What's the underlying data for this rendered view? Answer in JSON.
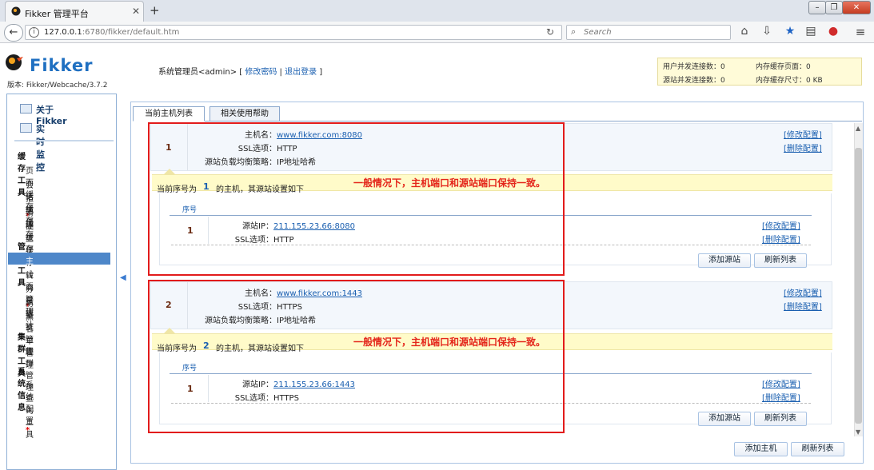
{
  "browser": {
    "tab_title": "Fikker 管理平台",
    "url_host": "127.0.0.1",
    "url_rest": ":6780/fikker/default.htm",
    "search_placeholder": "Search",
    "window_buttons": [
      "–",
      "❐",
      "✕"
    ],
    "new_tab": "+",
    "icons": [
      "back-icon",
      "info-icon",
      "reload-icon",
      "search-icon",
      "home-icon",
      "download-icon",
      "bookmark-star-icon",
      "reading-list-icon",
      "record-icon",
      "menu-icon"
    ]
  },
  "header": {
    "logo_text": "Fikker",
    "version": "版本: Fikker/Webcache/3.7.2",
    "user_prefix": "系统管理员<admin> [ ",
    "change_password": "修改密码",
    "separator": " | ",
    "logout": "退出登录",
    "user_suffix": " ]",
    "stats": {
      "user_conn_label": "用户并发连接数：0",
      "mem_pages_label": "内存缓存页面：0",
      "origin_conn_label": "源站并发连接数：0",
      "mem_size_label": "内存缓存尺寸：0 KB"
    }
  },
  "sidebar": {
    "top_items": [
      "关于Fikker",
      "实时监控"
    ],
    "groups": [
      {
        "title": "缓存工具",
        "items": [
          {
            "label": "页面缓存",
            "star": "*"
          },
          {
            "label": "会话缓存",
            "star": ""
          },
          {
            "label": "拒绝缓存",
            "star": ""
          },
          {
            "label": "清理缓存",
            "star": ""
          },
          {
            "label": "硬盘缓存设置",
            "star": ""
          }
        ]
      },
      {
        "title": "管理工具",
        "items": [
          {
            "label": "主机管理",
            "star": "*"
          },
          {
            "label": "转向管理",
            "star": ""
          },
          {
            "label": "分量统计",
            "star": ""
          },
          {
            "label": "防盗链管理",
            "star": ""
          },
          {
            "label": "黑名单管理",
            "star": ""
          }
        ]
      },
      {
        "title": "集群工具",
        "items": [
          {
            "label": "集群管理",
            "star": ""
          }
        ]
      },
      {
        "title": "系统信息",
        "items": [
          {
            "label": "系统配置",
            "star": "*"
          },
          {
            "label": "查询工具",
            "star": ""
          }
        ]
      }
    ],
    "active_item": "主机管理"
  },
  "content": {
    "tabs": [
      "当前主机列表",
      "相关使用帮助"
    ],
    "labels": {
      "hostname": "主机名：",
      "ssl": "SSL选项：",
      "balance": "源站负载均衡策略：",
      "origin_ip": "源站IP：",
      "seq": "序号",
      "edit": "[修改配置]",
      "delete": "[删除配置]",
      "current_seq": "当前序号为",
      "host_suffix": "的主机，其源站设置如下",
      "add_origin": "添加源站",
      "refresh": "刷新列表"
    },
    "hosts": [
      {
        "num": "1",
        "hostname": "www.fikker.com:8080",
        "ssl": "HTTP",
        "balance": "IP地址哈希",
        "note": "一般情况下，主机端口和源站端口保持一致。",
        "origins": [
          {
            "num": "1",
            "ip": "211.155.23.66:8080",
            "ssl": "HTTP"
          }
        ]
      },
      {
        "num": "2",
        "hostname": "www.fikker.com:1443",
        "ssl": "HTTPS",
        "balance": "IP地址哈希",
        "note": "一般情况下，主机端口和源站端口保持一致。",
        "origins": [
          {
            "num": "1",
            "ip": "211.155.23.66:1443",
            "ssl": "HTTPS"
          }
        ]
      }
    ],
    "bottom_buttons": [
      "添加主机",
      "刷新列表"
    ]
  },
  "colors": {
    "accent": "#1e6fc1",
    "highlight_box": "#e21b1b",
    "note_text": "#e4261b",
    "yellow_bar": "#fffbc9",
    "active_nav": "#4e87c9"
  }
}
